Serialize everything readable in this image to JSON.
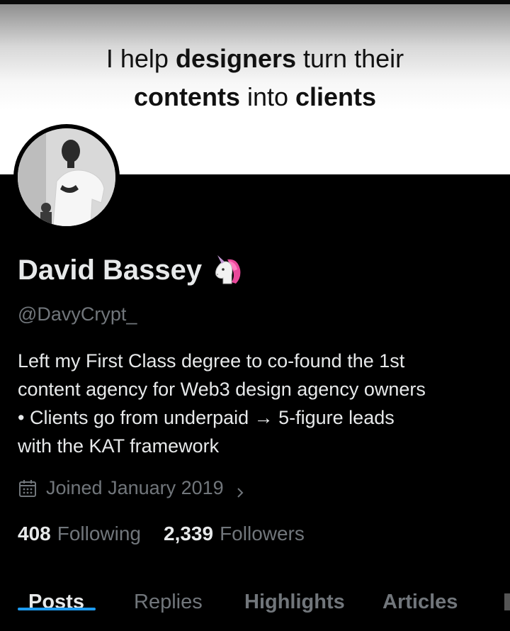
{
  "banner": {
    "line1_pre": "I help ",
    "line1_bold": "designers",
    "line1_post": " turn their",
    "line2_bold1": "contents",
    "line2_mid": " into ",
    "line2_bold2": "clients"
  },
  "profile": {
    "name": "David Bassey",
    "handle": "@DavyCrypt_",
    "bio": "Left my First Class degree to co-found the 1st\ncontent agency for Web3 design agency owners\n• Clients go from underpaid → 5-figure leads\nwith the KAT framework",
    "joined": "Joined January 2019",
    "following_count": "408",
    "following_label": "Following",
    "followers_count": "2,339",
    "followers_label": "Followers"
  },
  "tabs": [
    {
      "label": "Posts",
      "active": true
    },
    {
      "label": "Replies",
      "active": false
    },
    {
      "label": "Highlights",
      "active": false
    },
    {
      "label": "Articles",
      "active": false
    }
  ],
  "colors": {
    "background": "#000000",
    "text_primary": "#e7e9ea",
    "text_secondary": "#71767b",
    "accent": "#1d9bf0"
  },
  "icons": {
    "name_emoji": "unicorn-icon",
    "joined": "calendar-icon",
    "joined_chevron": "chevron-right-icon"
  }
}
